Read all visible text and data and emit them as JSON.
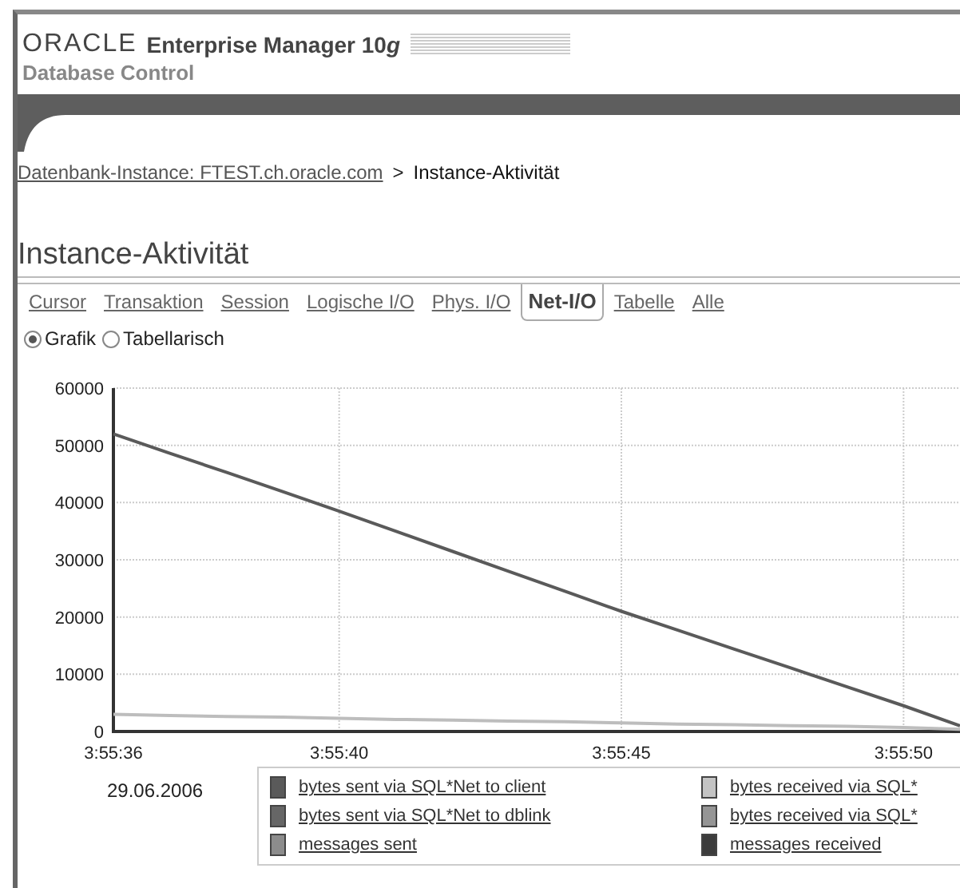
{
  "header": {
    "brand": "ORACLE",
    "product": "Enterprise Manager 10",
    "product_suffix": "g",
    "subtitle": "Database Control"
  },
  "breadcrumb": {
    "link": "Datenbank-Instance: FTEST.ch.oracle.com",
    "separator": ">",
    "current": "Instance-Aktivität"
  },
  "page_title": "Instance-Aktivität",
  "tabs": [
    {
      "label": "Cursor",
      "selected": false
    },
    {
      "label": "Transaktion",
      "selected": false
    },
    {
      "label": "Session",
      "selected": false
    },
    {
      "label": "Logische I/O",
      "selected": false
    },
    {
      "label": "Phys. I/O",
      "selected": false
    },
    {
      "label": "Net-I/O",
      "selected": true
    },
    {
      "label": "Tabelle",
      "selected": false
    },
    {
      "label": "Alle",
      "selected": false
    }
  ],
  "view_options": [
    {
      "label": "Grafik",
      "selected": true
    },
    {
      "label": "Tabellarisch",
      "selected": false
    }
  ],
  "chart": {
    "chart_data": {
      "type": "line",
      "categories": [
        "3:55:36",
        null,
        null,
        null,
        "3:55:40",
        null,
        null,
        null,
        null,
        "3:55:45",
        null,
        null,
        null,
        null,
        "3:55:50",
        null
      ],
      "ylim": [
        0,
        60000
      ],
      "grid": true,
      "yticks": [
        0,
        10000,
        20000,
        30000,
        40000,
        50000,
        60000
      ],
      "series": [
        {
          "color": "#5a5a5a",
          "values": [
            52000,
            48600,
            45300,
            41900,
            38500,
            35000,
            31500,
            28000,
            24500,
            21000,
            17700,
            14400,
            11100,
            7800,
            4500,
            1000
          ]
        },
        {
          "color": "#bdbdbd",
          "values": [
            3000,
            2800,
            2600,
            2500,
            2300,
            2100,
            2000,
            1800,
            1700,
            1500,
            1300,
            1200,
            1000,
            900,
            700,
            400
          ]
        }
      ]
    },
    "date": "29.06.2006"
  },
  "legend": [
    {
      "label": "bytes sent via SQL*Net to client",
      "color": "#5a5a5a"
    },
    {
      "label": "bytes received via SQL*",
      "color": "#c4c4c4"
    },
    {
      "label": "bytes sent via SQL*Net to dblink",
      "color": "#666666"
    },
    {
      "label": "bytes received via SQL*",
      "color": "#959595"
    },
    {
      "label": "messages sent",
      "color": "#8c8c8c"
    },
    {
      "label": "messages received",
      "color": "#3c3c3c"
    }
  ]
}
